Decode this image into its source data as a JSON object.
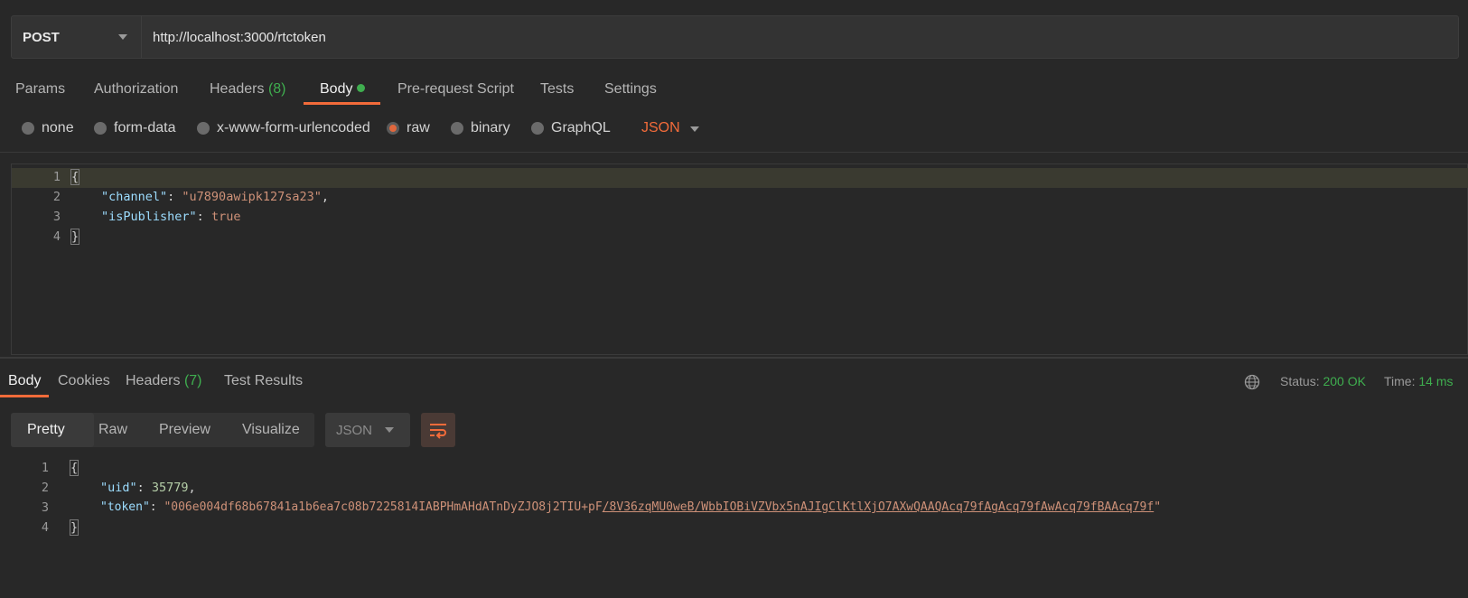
{
  "request": {
    "method": "POST",
    "url": "http://localhost:3000/rtctoken"
  },
  "req_tabs": {
    "params": "Params",
    "authorization": "Authorization",
    "headers": "Headers",
    "headers_count": "(8)",
    "body": "Body",
    "prerequest": "Pre-request Script",
    "tests": "Tests",
    "settings": "Settings"
  },
  "body_types": {
    "none": "none",
    "form_data": "form-data",
    "urlencoded": "x-www-form-urlencoded",
    "raw": "raw",
    "binary": "binary",
    "graphql": "GraphQL",
    "format": "JSON"
  },
  "req_body": {
    "line_numbers": [
      "1",
      "2",
      "3",
      "4"
    ],
    "open": "{",
    "close": "}",
    "key1": "\"channel\"",
    "val1": "\"u7890awipk127sa23\"",
    "key2": "\"isPublisher\"",
    "val2": "true"
  },
  "res_tabs": {
    "body": "Body",
    "cookies": "Cookies",
    "headers": "Headers",
    "headers_count": "(7)",
    "test_results": "Test Results"
  },
  "status": {
    "status_label": "Status:",
    "status_value": "200 OK",
    "time_label": "Time:",
    "time_value": "14 ms"
  },
  "formats": {
    "pretty": "Pretty",
    "raw": "Raw",
    "preview": "Preview",
    "visualize": "Visualize",
    "selected_type": "JSON"
  },
  "res_body": {
    "line_numbers": [
      "1",
      "2",
      "3",
      "4"
    ],
    "open": "{",
    "close": "}",
    "key1": "\"uid\"",
    "val1": "35779",
    "key2": "\"token\"",
    "val2_prefix": "\"006e004df68b67841a1b6ea7c08b7225814IABPHmAHdATnDyZJO8j2TIU+pF",
    "val2_link": "/8V36zqMU0weB/WbbIOBiVZVbx5nAJIgClKtlXjO7AXwQAAQAcq79fAgAcq79fAwAcq79fBAAcq79f",
    "val2_suffix": "\""
  },
  "colors": {
    "accent": "#f26b3a",
    "ok_green": "#3fae4f",
    "background": "#282828"
  }
}
